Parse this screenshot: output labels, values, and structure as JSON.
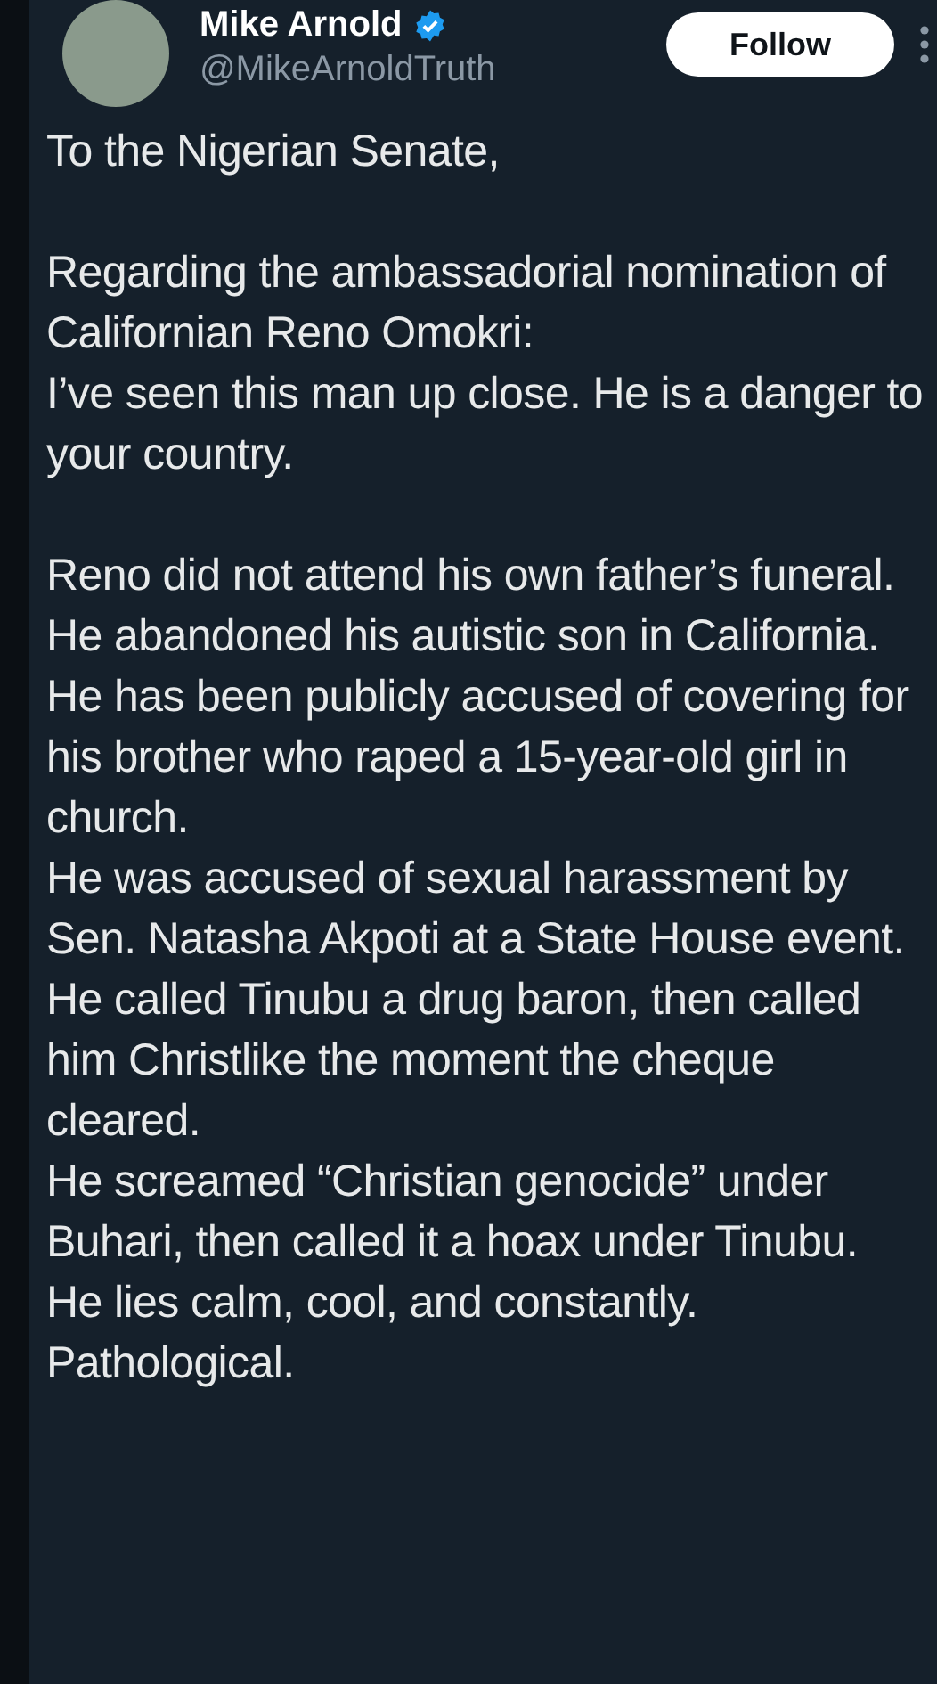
{
  "author": {
    "name": "Mike Arnold",
    "verified": true,
    "handle": "@MikeArnoldTruth"
  },
  "follow_button": {
    "label": "Follow"
  },
  "blocks": [
    {
      "lines": [
        "To the Nigerian Senate,"
      ]
    },
    {
      "lines": [
        "Regarding the ambassadorial nomination of Californian Reno Omokri:",
        "I’ve seen this man up close. He is a danger to your country."
      ]
    },
    {
      "lines": [
        "Reno did not attend his own father’s funeral.",
        "He abandoned his autistic son in California.",
        "He has been publicly accused of covering for his brother who raped a 15-year-old girl in church.",
        "He was accused of sexual harassment by Sen. Natasha Akpoti at a State House event.",
        "He called Tinubu a drug baron, then called him Christlike the moment the cheque cleared.",
        "He screamed “Christian genocide” under Buhari, then called it a hoax under Tinubu.",
        "He lies calm, cool, and constantly.",
        "Pathological."
      ]
    }
  ]
}
